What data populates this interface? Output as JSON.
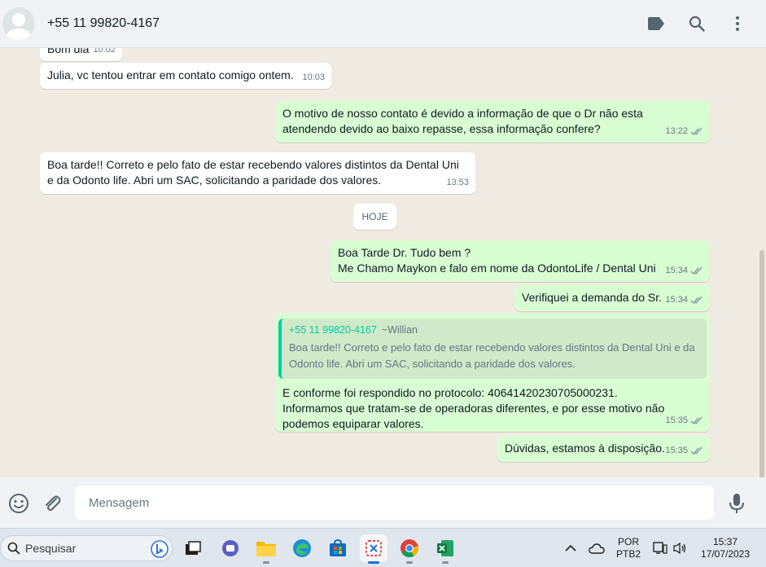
{
  "header": {
    "contact_name": "+55 11 99820-4167",
    "icons": [
      "label-icon",
      "search-icon",
      "menu-icon"
    ]
  },
  "messages": [
    {
      "dir": "in",
      "text": "Bom dia",
      "time": "10:02"
    },
    {
      "dir": "in",
      "text": "Julia, vc tentou entrar em contato comigo ontem.",
      "time": "10:03"
    },
    {
      "dir": "out",
      "text": "O motivo de nosso contato é devido a informação de que o Dr não esta\natendendo devido ao baixo repasse, essa informação confere?",
      "time": "13:22"
    },
    {
      "dir": "in",
      "text": "Boa tarde!! Correto e pelo fato de estar recebendo valores distintos da Dental Uni\ne da Odonto life. Abri um SAC, solicitando a paridade dos valores.",
      "time": "13:53"
    },
    {
      "dir": "out",
      "text": "Boa Tarde Dr. Tudo bem ?\nMe Chamo Maykon e falo em nome da OdontoLife / Dental Uni",
      "time": "15:34"
    },
    {
      "dir": "out",
      "text": "Verifiquei a demanda do Sr.",
      "time": "15:34"
    },
    {
      "dir": "out",
      "text": "E conforme foi respondido no protocolo: 40641420230705000231.\nInformamos que tratam-se de operadoras diferentes, e por esse motivo não\npodemos equiparar valores.",
      "time": "15:35",
      "quote": {
        "author": "+55 11 99820-4167",
        "alias": "~Willian",
        "text": "Boa tarde!! Correto e pelo fato de estar recebendo valores distintos da Dental Uni e da\nOdonto life. Abri um SAC, solicitando a paridade dos valores."
      }
    },
    {
      "dir": "out",
      "text": "Dúvidas, estamos à disposição.",
      "time": "15:35"
    }
  ],
  "date_divider": "HOJE",
  "composer": {
    "placeholder": "Mensagem"
  },
  "taskbar": {
    "search_label": "Pesquisar",
    "lang": "POR",
    "layout": "PTB2",
    "time": "15:37",
    "date": "17/07/2023"
  },
  "colors": {
    "outgoing": "#d9fdd3",
    "incoming": "#ffffff",
    "background": "#efeae2",
    "accent": "#06cf9c"
  }
}
